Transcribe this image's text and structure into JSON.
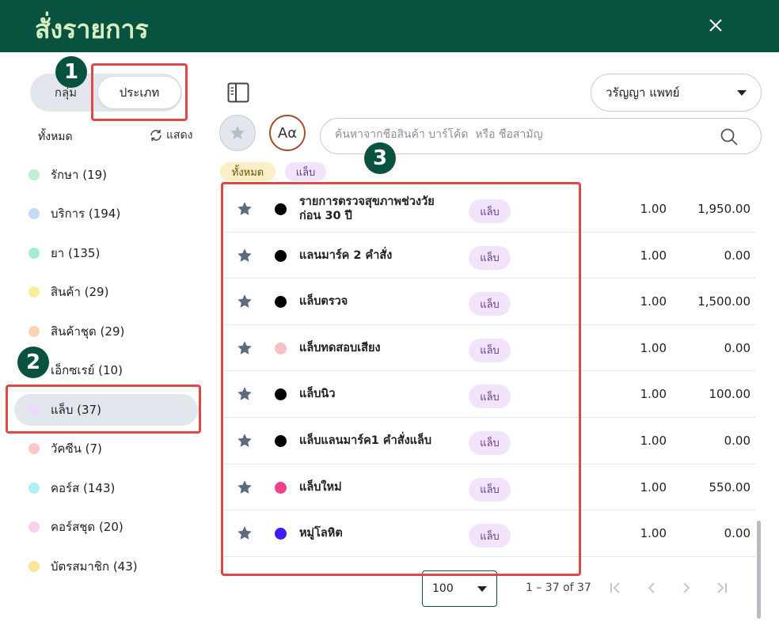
{
  "header": {
    "title": "สั่งรายการ"
  },
  "toggle": {
    "group_label": "กลุ่ม",
    "type_label": "ประเภท"
  },
  "filter": {
    "all_label": "ทั้งหมด",
    "show_label": "แสดง"
  },
  "categories": [
    {
      "label": "รักษา (19)",
      "color": "#bfeed1"
    },
    {
      "label": "บริการ (194)",
      "color": "#c4dbf8"
    },
    {
      "label": "ยา (135)",
      "color": "#a6ecd9"
    },
    {
      "label": "สินค้า (29)",
      "color": "#fbee9a"
    },
    {
      "label": "สินค้าชุด (29)",
      "color": "#fcd3b0"
    },
    {
      "label": "เอ็กซเรย์ (10)",
      "color": "#d4d8de"
    },
    {
      "label": "แล็บ (37)",
      "color": "#ecd9fb",
      "active": true
    },
    {
      "label": "วัคซีน (7)",
      "color": "#fbc7c7"
    },
    {
      "label": "คอร์ส (143)",
      "color": "#b2eef6"
    },
    {
      "label": "คอร์สชุด (20)",
      "color": "#fbd0ec"
    },
    {
      "label": "บัตรสมาชิก (43)",
      "color": "#fbe596"
    }
  ],
  "doctor": {
    "selected": "วรัญญา แพทย์"
  },
  "font_button": {
    "label": "Aα"
  },
  "search": {
    "placeholder": "ค้นหาจากชื่อสินค้า บาร์โค้ด  หรือ ชื่อสามัญ"
  },
  "chips": {
    "all": "ทั้งหมด",
    "lab": "แล็บ"
  },
  "items": [
    {
      "name": "รายการตรวจสุขภาพช่วงวัย ก่อน 30 ปี",
      "dot_color": "#000000",
      "badge": "แล็บ",
      "qty": "1.00",
      "price": "1,950.00"
    },
    {
      "name": "แลนมาร์ค 2 คำสั่ง",
      "dot_color": "#000000",
      "badge": "แล็บ",
      "qty": "1.00",
      "price": "0.00"
    },
    {
      "name": "แล็บตรวจ",
      "dot_color": "#000000",
      "badge": "แล็บ",
      "qty": "1.00",
      "price": "1,500.00"
    },
    {
      "name": "แล็บทดสอบเสียง",
      "dot_color": "#f7c1c6",
      "badge": "แล็บ",
      "qty": "1.00",
      "price": "0.00"
    },
    {
      "name": "แล็บนิว",
      "dot_color": "#000000",
      "badge": "แล็บ",
      "qty": "1.00",
      "price": "100.00"
    },
    {
      "name": "แล็บแลนมาร์ค1 คำสั่งแล็บ",
      "dot_color": "#000000",
      "badge": "แล็บ",
      "qty": "1.00",
      "price": "0.00"
    },
    {
      "name": "แล็บใหม่",
      "dot_color": "#f0418f",
      "badge": "แล็บ",
      "qty": "1.00",
      "price": "550.00"
    },
    {
      "name": "หมู่โลหิต",
      "dot_color": "#3a1ff0",
      "badge": "แล็บ",
      "qty": "1.00",
      "price": "0.00"
    }
  ],
  "pagination": {
    "page_size": "100",
    "range": "1 – 37 of 37"
  },
  "annotations": {
    "n1": "1",
    "n2": "2",
    "n3": "3"
  },
  "colors": {
    "header_bg": "#0a5240",
    "title": "#d6f0c4",
    "annotation": "#e04848",
    "lab_badge_bg": "#f1e4fb"
  }
}
